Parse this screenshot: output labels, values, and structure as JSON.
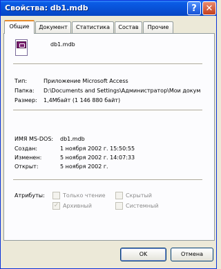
{
  "window": {
    "title": "Свойства: db1.mdb",
    "help_label": "?",
    "close_label": "✕"
  },
  "tabs": [
    {
      "label": "Общие",
      "active": true
    },
    {
      "label": "Документ",
      "active": false
    },
    {
      "label": "Статистика",
      "active": false
    },
    {
      "label": "Состав",
      "active": false
    },
    {
      "label": "Прочие",
      "active": false
    }
  ],
  "file": {
    "icon": "access-database-icon",
    "name": "db1.mdb"
  },
  "info": {
    "type_label": "Тип:",
    "type_value": "Приложение Microsoft Access",
    "folder_label": "Папка:",
    "folder_value": "D:\\Documents and Settings\\Администратор\\Мои докум",
    "size_label": "Размер:",
    "size_value": "1,4Мбайт (1 146 880 байт)"
  },
  "dates": {
    "msdos_label": "ИМЯ MS-DOS:",
    "msdos_value": "db1.mdb",
    "created_label": "Создан:",
    "created_value": "1 ноября 2002 г. 15:50:55",
    "modified_label": "Изменен:",
    "modified_value": "5 ноября 2002 г. 14:07:33",
    "opened_label": "Открыт:",
    "opened_value": "5 ноября 2002 г."
  },
  "attributes": {
    "label": "Атрибуты:",
    "readonly": {
      "label": "Только чтение",
      "checked": false
    },
    "hidden": {
      "label": "Скрытый",
      "checked": false
    },
    "archive": {
      "label": "Архивный",
      "checked": true
    },
    "system": {
      "label": "Системный",
      "checked": false
    }
  },
  "buttons": {
    "ok": "OK",
    "cancel": "Отмена"
  }
}
